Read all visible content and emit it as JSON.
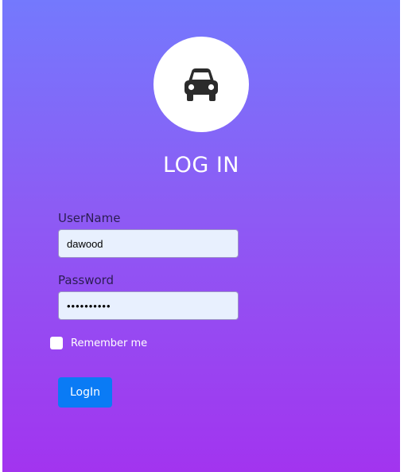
{
  "header": {
    "icon": "car-icon",
    "title": "LOG IN"
  },
  "form": {
    "username_label": "UserName",
    "username_value": "dawood",
    "password_label": "Password",
    "password_value": "••••••••••",
    "remember_label": "Remember me",
    "remember_checked": false,
    "login_label": "LogIn"
  },
  "colors": {
    "gradient_top": "#7479fd",
    "gradient_bottom": "#a234ef",
    "button": "#0a7bf5",
    "input_bg": "#e8f0fe"
  }
}
